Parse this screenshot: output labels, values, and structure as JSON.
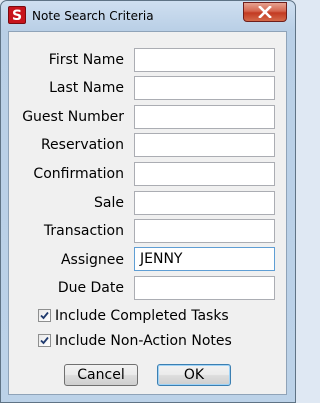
{
  "window": {
    "title": "Note Search Criteria",
    "app_icon_letter": "S"
  },
  "form": {
    "fields": [
      {
        "label": "First Name",
        "value": ""
      },
      {
        "label": "Last Name",
        "value": ""
      },
      {
        "label": "Guest Number",
        "value": ""
      },
      {
        "label": "Reservation",
        "value": ""
      },
      {
        "label": "Confirmation",
        "value": ""
      },
      {
        "label": "Sale",
        "value": ""
      },
      {
        "label": "Transaction",
        "value": ""
      },
      {
        "label": "Assignee",
        "value": "JENNY"
      },
      {
        "label": "Due Date",
        "value": ""
      }
    ],
    "checkboxes": [
      {
        "label": "Include Completed Tasks",
        "checked": true
      },
      {
        "label": "Include Non-Action Notes",
        "checked": true
      }
    ]
  },
  "buttons": {
    "cancel": "Cancel",
    "ok": "OK"
  },
  "colors": {
    "app_icon": "#c8141c",
    "close_button": "#c33a22",
    "dialog_background": "#f0f0f0"
  }
}
